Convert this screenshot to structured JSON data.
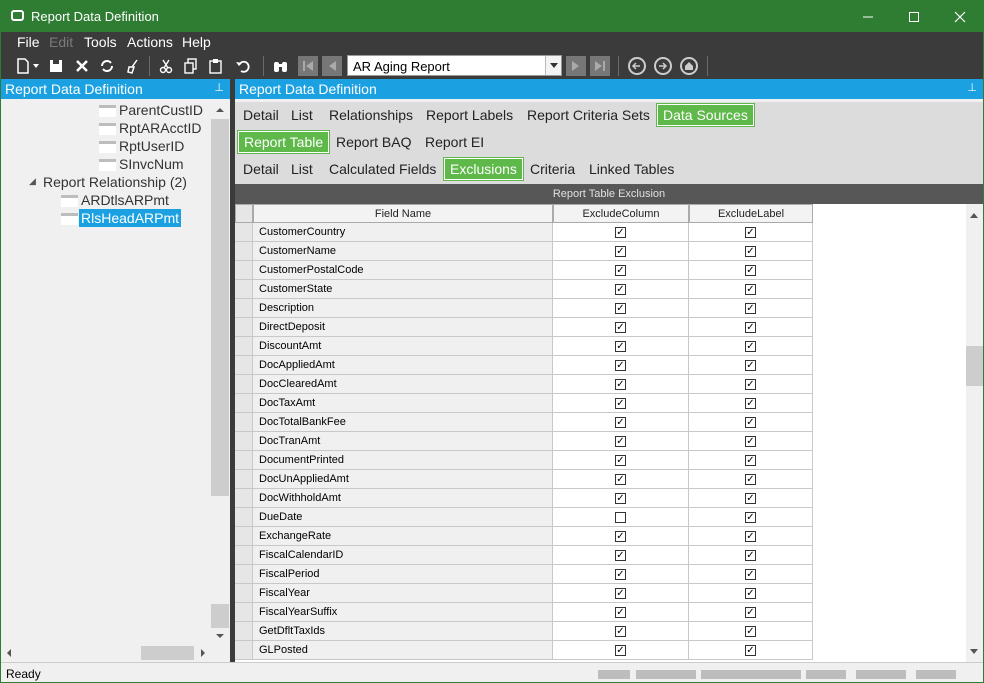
{
  "window": {
    "title": "Report Data Definition"
  },
  "menu": [
    "File",
    "Edit",
    "Tools",
    "Actions",
    "Help"
  ],
  "toolbar": {
    "report_combo": "AR Aging Report"
  },
  "left_panel": {
    "title": "Report Data Definition",
    "tree": [
      {
        "label": "ParentCustID",
        "kind": "folder"
      },
      {
        "label": "RptARAcctID",
        "kind": "folder"
      },
      {
        "label": "RptUserID",
        "kind": "folder"
      },
      {
        "label": "SInvcNum",
        "kind": "folder"
      },
      {
        "label": "Report Relationship (2)",
        "kind": "group"
      },
      {
        "label": "ARDtlsARPmt",
        "kind": "folder"
      },
      {
        "label": "RlsHeadARPmt",
        "kind": "folder",
        "selected": true
      }
    ]
  },
  "right_panel": {
    "title": "Report Data Definition",
    "tabs_level1": [
      "Detail",
      "List",
      "Relationships",
      "Report Labels",
      "Report Criteria Sets",
      "Data Sources"
    ],
    "tabs_level2": [
      "Report Table",
      "Report BAQ",
      "Report EI"
    ],
    "tabs_level3": [
      "Detail",
      "List",
      "Calculated Fields",
      "Exclusions",
      "Criteria",
      "Linked Tables"
    ],
    "active": {
      "level1": "Data Sources",
      "level2": "Report Table",
      "level3": "Exclusions"
    },
    "grid": {
      "title": "Report Table Exclusion",
      "columns": [
        "Field Name",
        "ExcludeColumn",
        "ExcludeLabel"
      ],
      "rows": [
        {
          "field": "CustomerCountry",
          "exclude_column": true,
          "exclude_label": true
        },
        {
          "field": "CustomerName",
          "exclude_column": true,
          "exclude_label": true
        },
        {
          "field": "CustomerPostalCode",
          "exclude_column": true,
          "exclude_label": true
        },
        {
          "field": "CustomerState",
          "exclude_column": true,
          "exclude_label": true
        },
        {
          "field": "Description",
          "exclude_column": true,
          "exclude_label": true
        },
        {
          "field": "DirectDeposit",
          "exclude_column": true,
          "exclude_label": true
        },
        {
          "field": "DiscountAmt",
          "exclude_column": true,
          "exclude_label": true
        },
        {
          "field": "DocAppliedAmt",
          "exclude_column": true,
          "exclude_label": true
        },
        {
          "field": "DocClearedAmt",
          "exclude_column": true,
          "exclude_label": true
        },
        {
          "field": "DocTaxAmt",
          "exclude_column": true,
          "exclude_label": true
        },
        {
          "field": "DocTotalBankFee",
          "exclude_column": true,
          "exclude_label": true
        },
        {
          "field": "DocTranAmt",
          "exclude_column": true,
          "exclude_label": true
        },
        {
          "field": "DocumentPrinted",
          "exclude_column": true,
          "exclude_label": true
        },
        {
          "field": "DocUnAppliedAmt",
          "exclude_column": true,
          "exclude_label": true
        },
        {
          "field": "DocWithholdAmt",
          "exclude_column": true,
          "exclude_label": true
        },
        {
          "field": "DueDate",
          "exclude_column": false,
          "exclude_label": true
        },
        {
          "field": "ExchangeRate",
          "exclude_column": true,
          "exclude_label": true
        },
        {
          "field": "FiscalCalendarID",
          "exclude_column": true,
          "exclude_label": true
        },
        {
          "field": "FiscalPeriod",
          "exclude_column": true,
          "exclude_label": true
        },
        {
          "field": "FiscalYear",
          "exclude_column": true,
          "exclude_label": true
        },
        {
          "field": "FiscalYearSuffix",
          "exclude_column": true,
          "exclude_label": true
        },
        {
          "field": "GetDfltTaxIds",
          "exclude_column": true,
          "exclude_label": true
        },
        {
          "field": "GLPosted",
          "exclude_column": true,
          "exclude_label": true
        }
      ]
    }
  },
  "status": {
    "text": "Ready"
  },
  "colors": {
    "titlebar": "#2e7d32",
    "panel_header": "#1ba1e2",
    "active_tab": "#5fb84a",
    "dark_bar": "#3b3b3b"
  }
}
